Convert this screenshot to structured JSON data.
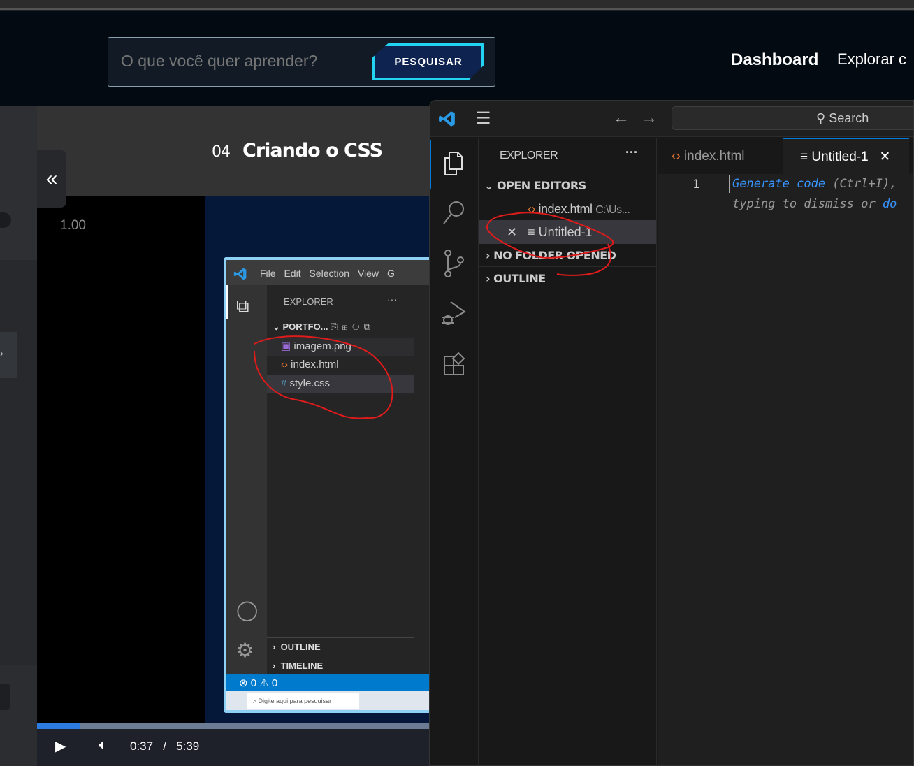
{
  "header": {
    "search_placeholder": "O que você quer aprender?",
    "search_button": "PESQUISAR",
    "nav": [
      "Dashboard",
      "Explorar c"
    ]
  },
  "lesson": {
    "number": "04",
    "title": "Criando o CSS",
    "collapse_icon": "«"
  },
  "player": {
    "speed": "1.00",
    "current_time": "0:37",
    "separator": "/",
    "duration": "5:39",
    "progress": 0.109,
    "colors": {
      "fill": "#2c7be0",
      "track": "#6b7c94"
    }
  },
  "video_frame": {
    "menu": [
      "File",
      "Edit",
      "Selection",
      "View",
      "G"
    ],
    "explorer": "EXPLORER",
    "folder": "PORTFO...",
    "files": [
      {
        "name": "imagem.png",
        "icon": "image-icon"
      },
      {
        "name": "index.html",
        "icon": "html-icon"
      },
      {
        "name": "style.css",
        "icon": "css-icon"
      }
    ],
    "sections": [
      "OUTLINE",
      "TIMELINE"
    ],
    "status": {
      "errors": "0",
      "warnings": "0"
    },
    "taskbar_search": "Digite aqui para pesquisar"
  },
  "vscode": {
    "search": "Search",
    "explorer": "EXPLORER",
    "more": "···",
    "open_editors": "OPEN EDITORS",
    "editors": [
      {
        "name": "index.html",
        "path": "C:\\Us..."
      },
      {
        "name": "Untitled-1"
      }
    ],
    "no_folder": "NO FOLDER OPENED",
    "outline": "OUTLINE",
    "tabs": [
      {
        "name": "index.html"
      },
      {
        "name": "Untitled-1",
        "active": true
      }
    ],
    "line_number": "1",
    "hint": {
      "link1": "Generate code",
      "text1": " (Ctrl+I),",
      "text2": "typing to dismiss or ",
      "link2": "do"
    },
    "accent": "#0078d4"
  }
}
